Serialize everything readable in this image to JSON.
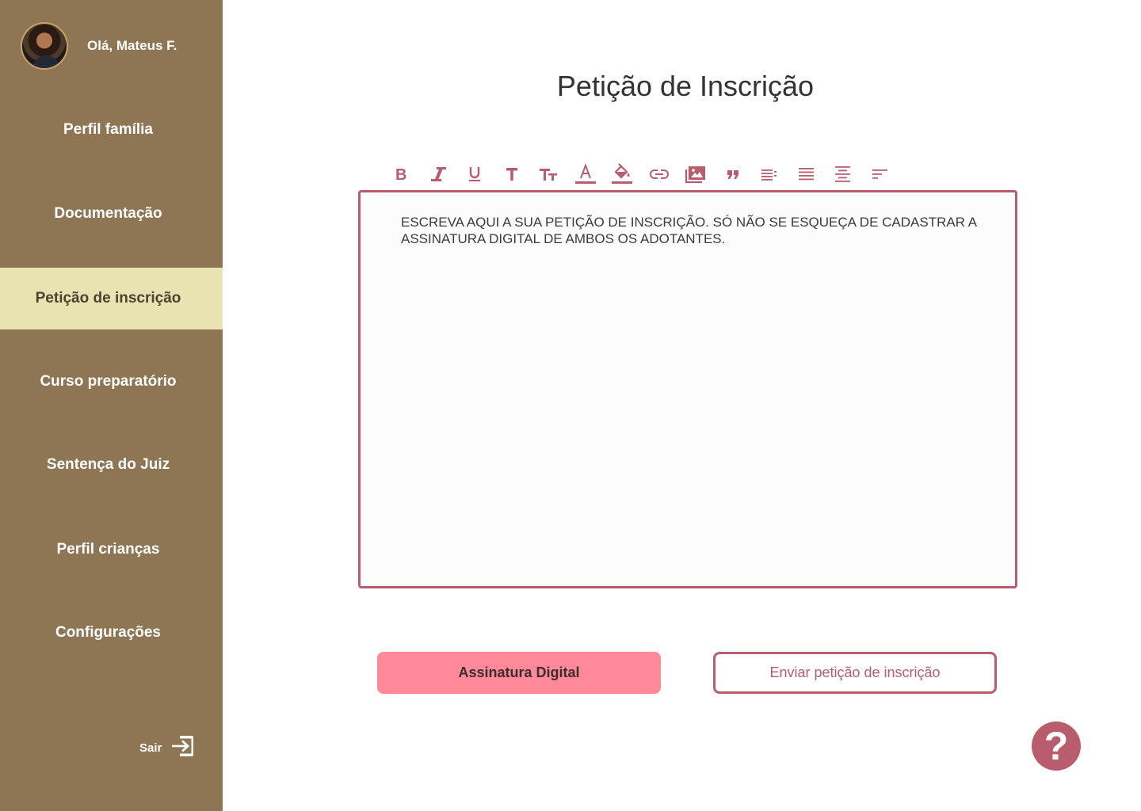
{
  "user": {
    "greeting": "Olá, Mateus F."
  },
  "sidebar": {
    "items": [
      {
        "label": "Perfil família"
      },
      {
        "label": "Documentação"
      },
      {
        "label": "Petição de inscrição",
        "active": true
      },
      {
        "label": "Curso preparatório"
      },
      {
        "label": "Sentença do Juiz"
      },
      {
        "label": "Perfil crianças"
      },
      {
        "label": "Configurações"
      }
    ],
    "logout_label": "Sair"
  },
  "main": {
    "title": "Petição de Inscrição",
    "toolbar": [
      "bold-icon",
      "italic-icon",
      "underline-icon",
      "text-icon",
      "text-size-icon",
      "font-color-icon",
      "fill-color-icon",
      "link-icon",
      "image-icon",
      "quote-icon",
      "align-left-list-icon",
      "justify-icon",
      "align-center-icon",
      "align-right-short-icon"
    ],
    "editor_text": "ESCREVA AQUI A SUA PETIÇÃO DE INSCRIÇÃO. SÓ NÃO SE ESQUEÇA DE CADASTRAR A ASSINATURA DIGITAL DE AMBOS OS ADOTANTES.",
    "sign_button": "Assinatura Digital",
    "send_button": "Enviar petição de inscrição",
    "help_label": "?"
  },
  "colors": {
    "sidebar": "#8e7554",
    "active": "#e8e3b0",
    "accent": "#b95d6e",
    "primary_button": "#ff8899"
  }
}
